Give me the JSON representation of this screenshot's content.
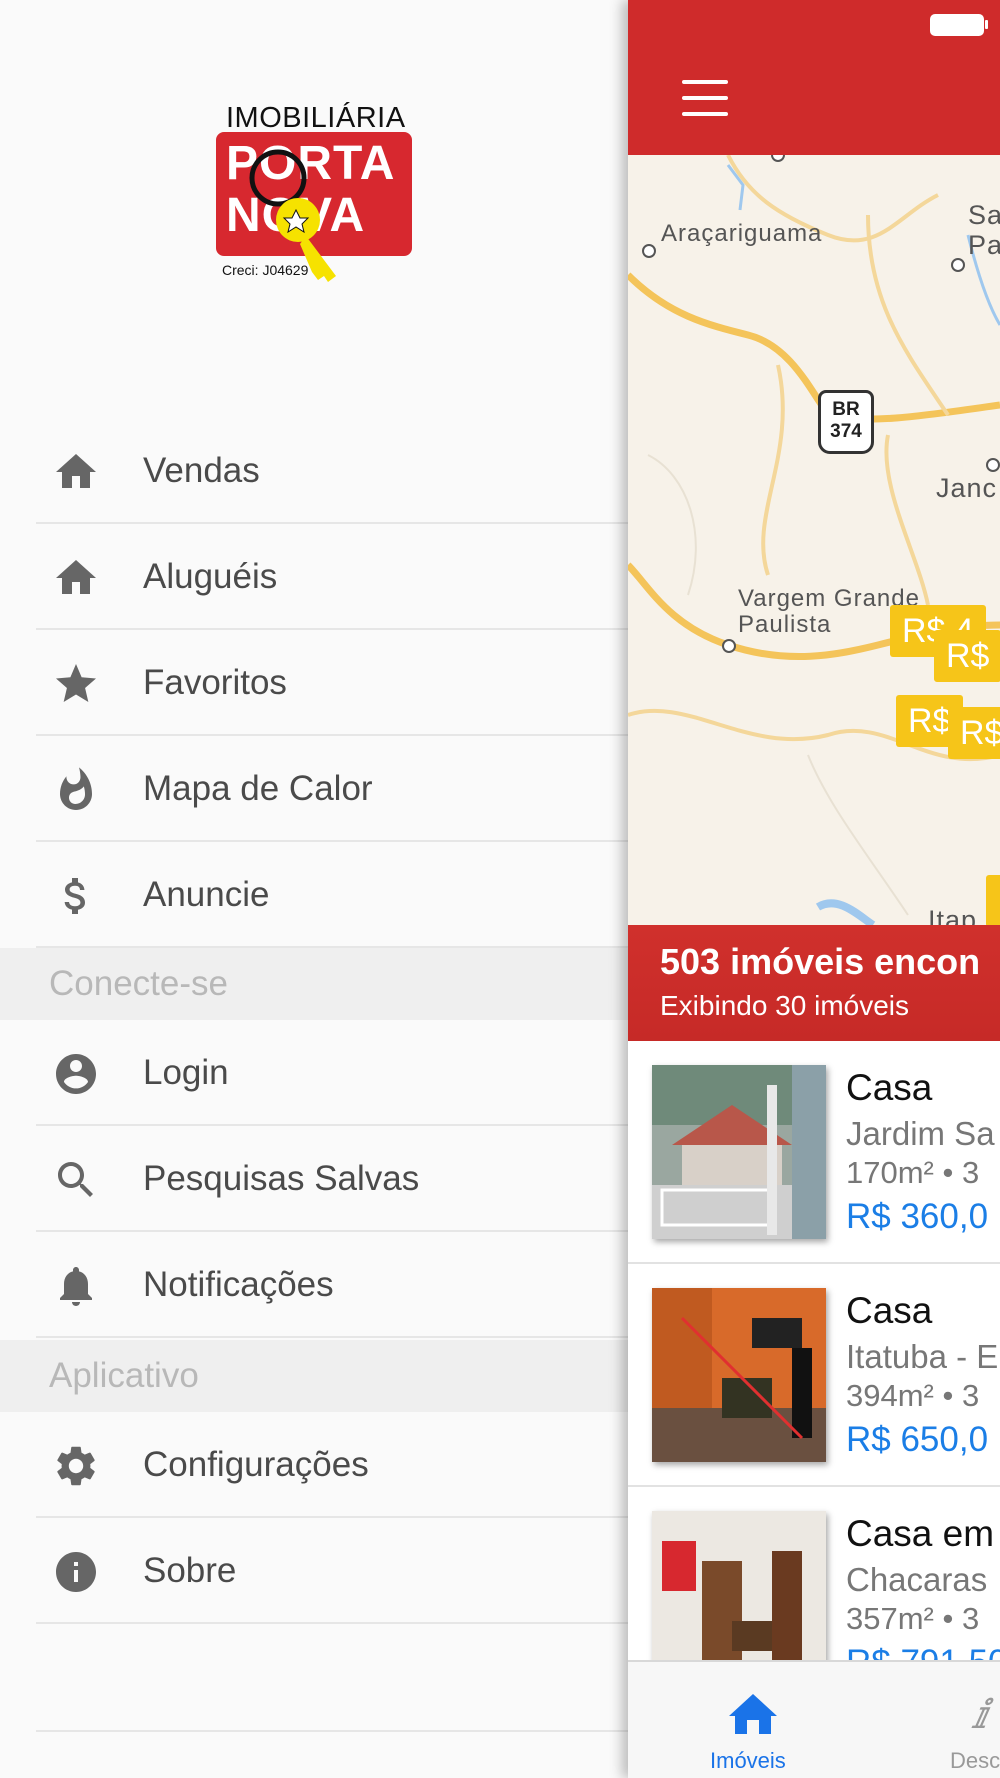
{
  "logo": {
    "top_text": "IMOBILIÁRIA",
    "line1": "PORTA",
    "line2": "NOVA",
    "creci": "Creci: J04629"
  },
  "menu": {
    "items": [
      {
        "label": "Vendas",
        "icon": "home-icon"
      },
      {
        "label": "Aluguéis",
        "icon": "home-icon"
      },
      {
        "label": "Favoritos",
        "icon": "star-icon"
      },
      {
        "label": "Mapa de Calor",
        "icon": "fire-icon"
      },
      {
        "label": "Anuncie",
        "icon": "dollar-icon"
      }
    ],
    "section_connect": "Conecte-se",
    "connect_items": [
      {
        "label": "Login",
        "icon": "account-icon"
      },
      {
        "label": "Pesquisas Salvas",
        "icon": "search-icon"
      },
      {
        "label": "Notificações",
        "icon": "bell-icon"
      }
    ],
    "section_app": "Aplicativo",
    "app_items": [
      {
        "label": "Configurações",
        "icon": "gear-icon"
      },
      {
        "label": "Sobre",
        "icon": "info-icon"
      }
    ]
  },
  "header": {
    "menu_icon": "hamburger-icon"
  },
  "map": {
    "labels": [
      "Araçariguama",
      "Sa",
      "Pa",
      "Janc",
      "Vargem Grande",
      "Paulista",
      "Itap"
    ],
    "road_shield": [
      "BR",
      "374"
    ],
    "price_pins": [
      "R$ 4",
      "R$",
      "R$",
      "R$"
    ]
  },
  "results": {
    "count_text": "503 imóveis encon",
    "showing_text": "Exibindo 30 imóveis"
  },
  "listings": [
    {
      "title": "Casa",
      "location": "Jardim Sa",
      "area": "170m² • 3",
      "price": "R$ 360,0"
    },
    {
      "title": "Casa",
      "location": "Itatuba - E",
      "area": "394m² • 3",
      "price": "R$ 650,0"
    },
    {
      "title": "Casa em",
      "location": "Chacaras",
      "area": "357m² • 3",
      "price": "R$ 791,50"
    }
  ],
  "tabbar": {
    "tab1_label": "Imóveis",
    "tab2_label": "Desc"
  },
  "colors": {
    "brand_red": "#cf2b2b",
    "pin_yellow": "#f6c519",
    "price_blue": "#1b7ee6",
    "icon_gray": "#666666"
  }
}
